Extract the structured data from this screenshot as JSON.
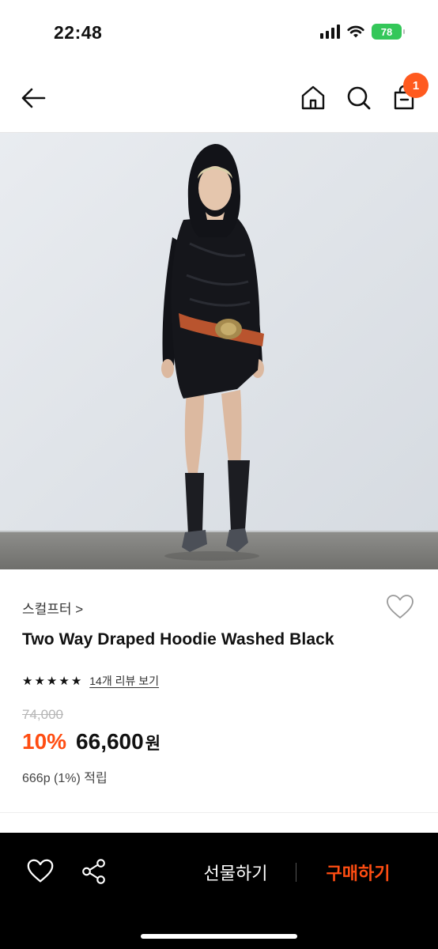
{
  "status_bar": {
    "time": "22:48",
    "battery": "78",
    "battery_color": "#34c759",
    "icons": [
      "signal-icon",
      "wifi-icon",
      "battery-icon"
    ]
  },
  "header": {
    "icons": [
      "back-arrow-icon",
      "home-icon",
      "search-icon",
      "shopping-bag-icon"
    ],
    "cart_count": "1",
    "badge_color": "#ff5a1f"
  },
  "product": {
    "image": "model-in-black-draped-hoodie-dress-photo",
    "brand": "스컬프터 >",
    "name": "Two Way Draped Hoodie Washed Black",
    "rating_stars": 5,
    "review_link": "14개 리뷰 보기",
    "original_price": "74,000",
    "discount": "10%",
    "sale_price": "66,600",
    "currency": "원",
    "points": "666p (1%) 적립",
    "accent_color": "#ff4d12"
  },
  "bottom_bar": {
    "icons": [
      "heart-icon",
      "share-icon"
    ],
    "gift_label": "선물하기",
    "buy_label": "구매하기",
    "buy_color": "#ff4d12"
  }
}
